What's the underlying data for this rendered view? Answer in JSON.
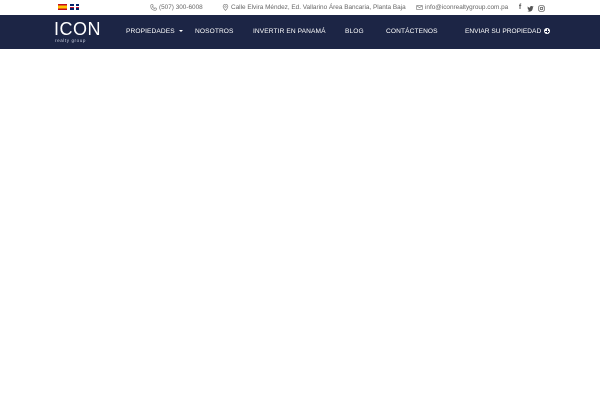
{
  "topbar": {
    "languages": [
      {
        "code": "es",
        "icon": "spain-flag-icon"
      },
      {
        "code": "en",
        "icon": "uk-flag-icon"
      }
    ],
    "phone": "(507) 300-6008",
    "address": "Calle Elvira Méndez, Ed. Vallarino Área Bancaria, Planta Baja",
    "email": "info@iconrealtygroup.com.pa",
    "social": {
      "facebook": "f",
      "twitter": "🐦",
      "instagram": "◎"
    }
  },
  "header": {
    "logo_main": "ICON",
    "logo_sub": "realty group",
    "nav": [
      "PROPIEDADES",
      "NOSOTROS",
      "INVERTIR EN PANAMÁ",
      "BLOG",
      "CONTÁCTENOS"
    ],
    "cta": "ENVIAR SU PROPIEDAD",
    "bg_color": "#1c2545"
  }
}
